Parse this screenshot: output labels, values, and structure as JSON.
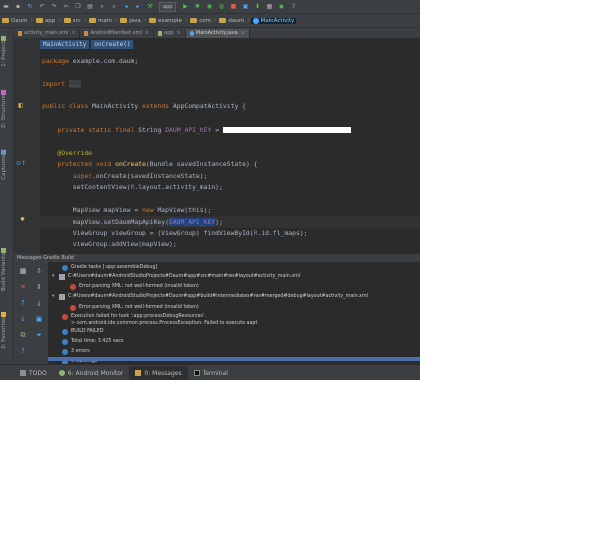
{
  "navbar": {
    "crumbs": [
      "Daum",
      "app",
      "src",
      "main",
      "java",
      "example",
      "com",
      "daum",
      "MainActivity"
    ]
  },
  "toolbar": {
    "run_config": "app"
  },
  "tabs": [
    {
      "label": "activity_main.xml",
      "active": false
    },
    {
      "label": "AndroidManifest.xml",
      "active": false
    },
    {
      "label": "app",
      "active": false
    },
    {
      "label": "MainActivity.java",
      "active": true
    }
  ],
  "side_tabs": {
    "project": "1: Project",
    "structure": "Z: Structure",
    "captures": "Captures",
    "build_variants": "Build Variants",
    "favorites": "2: Favorites"
  },
  "editor": {
    "crumb_class": "MainActivity",
    "crumb_method": "onCreate()",
    "lines": {
      "package": "example.com.daum;",
      "import": "...",
      "class_name": "MainActivity",
      "super_class": "AppCompatActivity {",
      "field_type": "String",
      "field_name": "DAUM_API_KEY",
      "field_eq": "=",
      "override": "@Override",
      "method_sig": "onCreate",
      "method_args": "(Bundle savedInstanceState) {",
      "super_call": "onCreate(savedInstanceState);",
      "set_content": "setContentView(",
      "set_content_arg": "R",
      "set_content_rest": ".layout.activity_main);",
      "map_view_decl": "MapView mapView = ",
      "map_view_new": "MapView(this);",
      "set_key": "mapView.setDaumMapApiKey(",
      "set_key_arg": "DAUM_API_KEY",
      "set_key_end": ");",
      "view_group": "ViewGroup viewGroup = (ViewGroup) findViewById(",
      "view_group_arg": "R",
      "view_group_rest": ".id.fl_maps);",
      "add_view": "viewGroup.addView(mapView);"
    },
    "keywords": {
      "package": "package",
      "import": "import",
      "public": "public",
      "class": "class",
      "extends": "extends",
      "private": "private",
      "static": "static",
      "final": "final",
      "protected": "protected",
      "void": "void",
      "super": "super",
      "new": "new"
    }
  },
  "messages": {
    "header": "Messages Gradle Build",
    "items": [
      {
        "type": "info",
        "indent": 0,
        "text": "Gradle tasks [:app:assembleDebug]"
      },
      {
        "type": "file",
        "indent": 0,
        "text": "C:#Users#daum#AndroidStudioProjects#Daum#app#src#main#res#layout#activity_main.xml"
      },
      {
        "type": "error",
        "indent": 1,
        "text": "Error:parsing XML: not well-formed (invalid token)"
      },
      {
        "type": "file",
        "indent": 0,
        "text": "C:#Users#daum#AndroidStudioProjects#Daum#app#build#intermediates#res#merged#debug#layout#activity_main.xml"
      },
      {
        "type": "error",
        "indent": 1,
        "text": "Error:parsing XML: not well-formed (invalid token)"
      },
      {
        "type": "error",
        "indent": 0,
        "text": "Execution failed for task ':app:processDebugResources'."
      },
      {
        "type": "none",
        "indent": 0,
        "text": "> com.android.ide.common.process.ProcessException: Failed to execute aapt"
      },
      {
        "type": "info",
        "indent": 0,
        "text": "BUILD FAILED"
      },
      {
        "type": "info",
        "indent": 0,
        "text": "Total time: 3.425 secs"
      },
      {
        "type": "info",
        "indent": 0,
        "text": "3 errors"
      },
      {
        "type": "info",
        "indent": 0,
        "text": "0 warnings"
      }
    ]
  },
  "statusbar": {
    "todo": "TODO",
    "android_monitor": "6: Android Monitor",
    "messages": "0: Messages",
    "terminal": "Terminal"
  },
  "colors": {
    "ide_background": "#2b2b2b",
    "panel": "#3c3f41",
    "keyword": "#cc7832",
    "string": "#6a8759",
    "field": "#9876aa",
    "selection": "#214283"
  }
}
